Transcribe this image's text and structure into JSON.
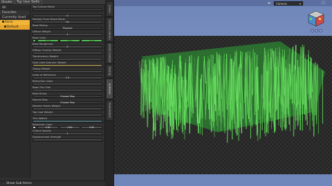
{
  "panel": {
    "header_left": "Shader",
    "header_selector": "Top User Defin"
  },
  "tree": {
    "items": [
      {
        "label": "All"
      },
      {
        "label": "Favorites"
      },
      {
        "label": "Currently Used"
      },
      {
        "label": "Ferro"
      },
      {
        "label": "Default"
      }
    ]
  },
  "properties": [
    {
      "label": "Top Surface Mode",
      "kind": "bar",
      "value": "",
      "style": "dark"
    },
    {
      "label": "",
      "kind": "bar",
      "value": "0",
      "style": "normal"
    },
    {
      "label": "Multiply From Mixee Mode",
      "kind": "bar",
      "value": "On",
      "style": "normal"
    },
    {
      "label": "Base Mixing",
      "kind": "bar",
      "value": "Physical",
      "style": "dark"
    },
    {
      "label": "Diffuse Weight",
      "kind": "bar",
      "value": "1",
      "style": "normal"
    },
    {
      "label": "Base Color",
      "kind": "segs",
      "values": [
        "0.14",
        "0.83",
        "0.24"
      ],
      "style": "green"
    },
    {
      "label": "Base Roughness",
      "kind": "bar",
      "value": "0",
      "style": "normal"
    },
    {
      "label": "Diffuse Overlay Weight",
      "kind": "bar",
      "value": "",
      "style": "normal"
    },
    {
      "label": "Translucency Weight",
      "kind": "bar",
      "value": "",
      "style": "normal"
    },
    {
      "label": "Dual Lobe Specular Weight",
      "kind": "bar",
      "value": "",
      "style": "tan"
    },
    {
      "label": "Glossy Weight",
      "kind": "bar",
      "value": "",
      "style": "normal"
    },
    {
      "label": "Index of Refraction",
      "kind": "bar",
      "value": "1.5",
      "style": "normal"
    },
    {
      "label": "Refraction Index",
      "kind": "bar",
      "value": "",
      "style": "normal"
    },
    {
      "label": "Base Thin Film",
      "kind": "bar",
      "value": "",
      "style": "normal"
    },
    {
      "label": "Base Bump",
      "kind": "bar",
      "value": "Choose Map",
      "style": "dark"
    },
    {
      "label": "Normal Map",
      "kind": "bar",
      "value": "Choose Map",
      "style": "dark"
    },
    {
      "label": "Metallic Flakes Weight",
      "kind": "bar",
      "value": "",
      "style": "normal"
    },
    {
      "label": "Top Coat Weight",
      "kind": "bar",
      "value": "",
      "style": "normal"
    },
    {
      "label": "Thin Walled",
      "kind": "bar",
      "value": "",
      "style": "cyan"
    },
    {
      "label": "Refraction Color",
      "kind": "segs",
      "values": [
        "0.80",
        "0.80",
        "0.80"
      ],
      "style": "normal"
    },
    {
      "label": "Cutout Opacity",
      "kind": "bar",
      "value": "1",
      "style": "normal"
    },
    {
      "label": "Displacement Strength",
      "kind": "bar",
      "value": "",
      "style": "normal"
    }
  ],
  "bottom": {
    "show_sub_items": "Show Sub Items"
  },
  "vtabs": [
    {
      "label": "Scene"
    },
    {
      "label": "Content Library"
    },
    {
      "label": "Smart Content"
    },
    {
      "label": "Posing"
    },
    {
      "label": "Surfaces"
    },
    {
      "label": "Parameters"
    }
  ],
  "viewport": {
    "camera": "Camera"
  },
  "colors": {
    "accent": "#f2b53a",
    "grass": "#5fd05f",
    "viewport_bg": "#7a8fc2"
  }
}
